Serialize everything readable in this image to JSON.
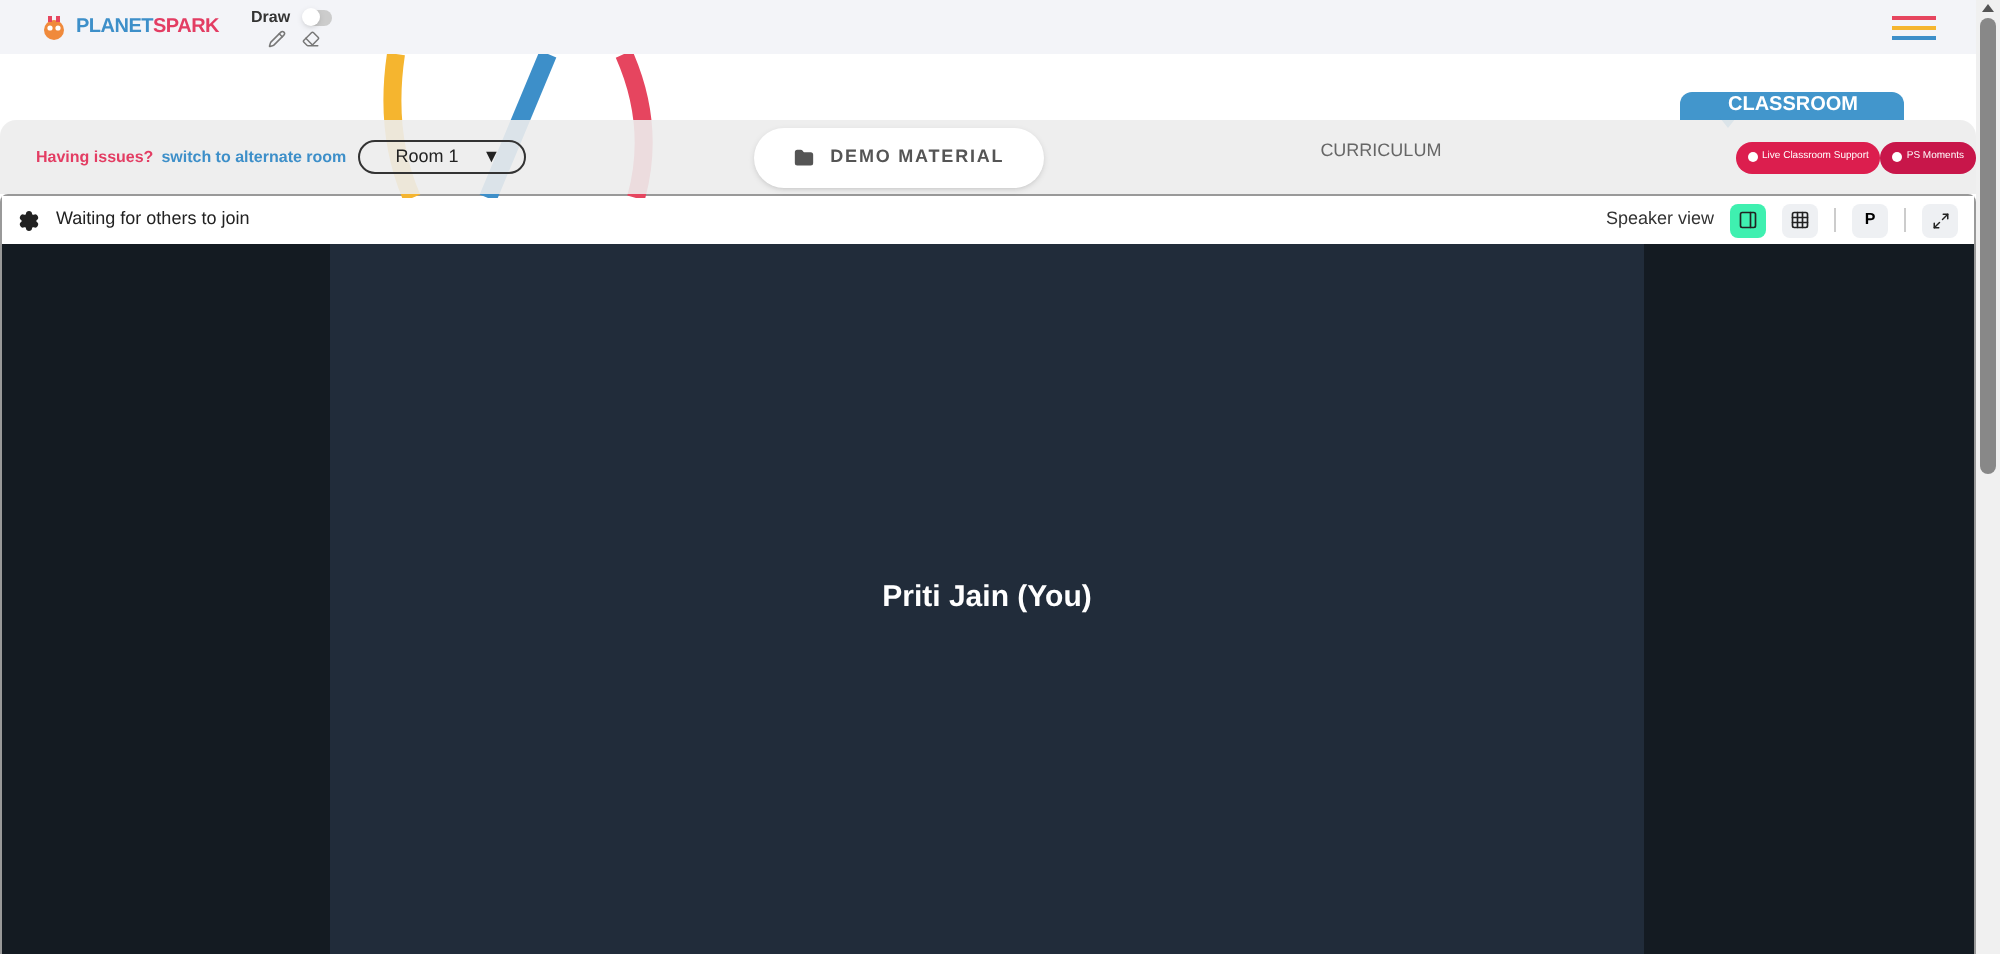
{
  "header": {
    "logo": {
      "part_1": "PLANET",
      "part_2": "SPARK"
    },
    "draw": {
      "label": "Draw",
      "on": false
    }
  },
  "room_bar": {
    "issue_text": "Having issues?",
    "switch_link": "switch to alternate room",
    "room_select": {
      "value": "Room 1",
      "caret": "▼"
    },
    "tabs": [
      {
        "label": "DEMO MATERIAL",
        "selected": true
      },
      {
        "label": "CURRICULUM",
        "selected": false
      }
    ],
    "classroom_label": "CLASSROOM",
    "buttons": [
      "Live Classroom Support",
      "PS Moments"
    ]
  },
  "video": {
    "status": "Waiting for others to join",
    "view_label": "Speaker view",
    "views": [
      {
        "kind": "speaker",
        "selected": true
      },
      {
        "kind": "grid",
        "selected": false
      }
    ],
    "p_button": "P",
    "participant": "Priti Jain (You)"
  }
}
